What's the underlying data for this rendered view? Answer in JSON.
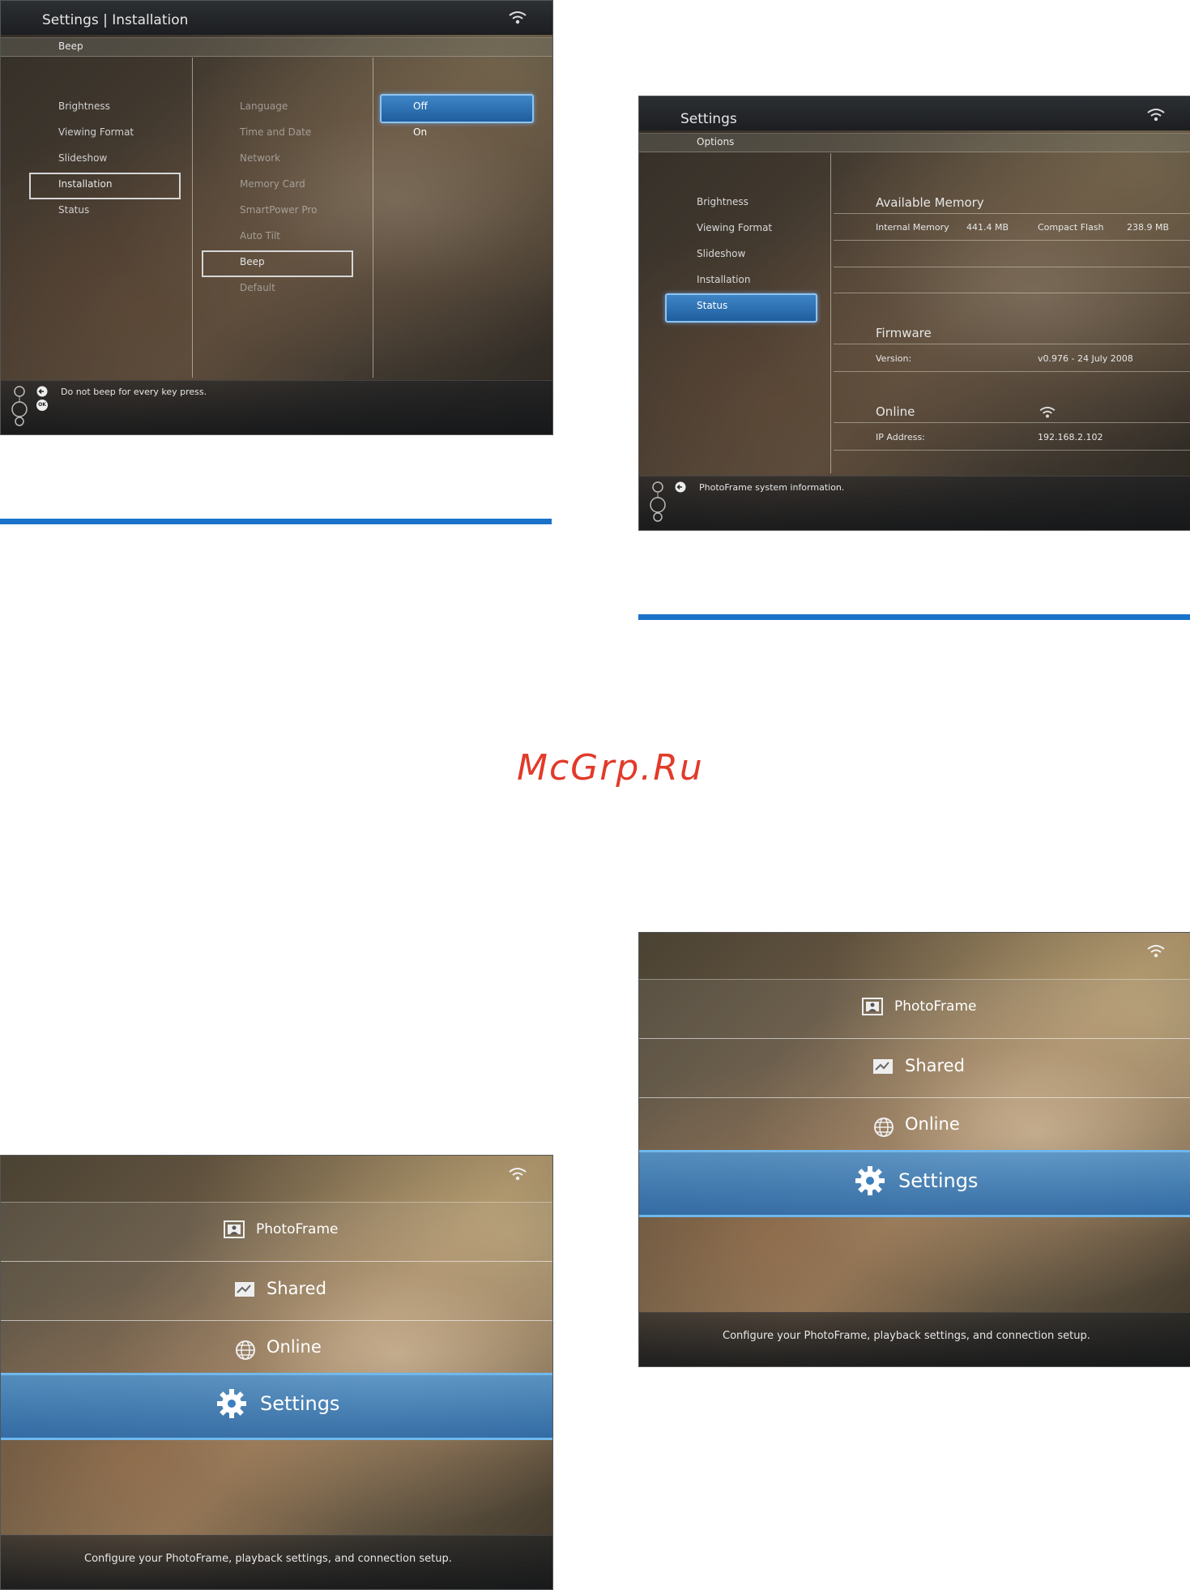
{
  "screen1": {
    "title": "Settings | Installation",
    "subtitle": "Beep",
    "left_menu": [
      "Brightness",
      "Viewing Format",
      "Slideshow",
      "Installation",
      "Status"
    ],
    "left_selected": "Installation",
    "mid_menu": [
      "Language",
      "Time and Date",
      "Network",
      "Memory Card",
      "SmartPower Pro",
      "Auto Tilt",
      "Beep",
      "Default"
    ],
    "mid_selected": "Beep",
    "options": [
      "Off",
      "On"
    ],
    "option_selected": "Off",
    "footer_text": "Do not beep for every key press.",
    "ok_label": "OK",
    "icons": [
      "wifi-icon",
      "back-icon",
      "ok-icon",
      "navigation-icon"
    ]
  },
  "screen2": {
    "title": "Settings",
    "subtitle": "Options",
    "left_menu": [
      "Brightness",
      "Viewing Format",
      "Slideshow",
      "Installation",
      "Status"
    ],
    "left_selected": "Status",
    "memory_heading": "Available Memory",
    "internal_memory_label": "Internal Memory",
    "internal_memory_value": "441.4 MB",
    "compact_flash_label": "Compact Flash",
    "compact_flash_value": "238.9 MB",
    "firmware_heading": "Firmware",
    "version_label": "Version:",
    "version_value": "v0.976 - 24 July 2008",
    "online_heading": "Online",
    "ip_label": "IP Address:",
    "ip_value": "192.168.2.102",
    "footer_text": "PhotoFrame system information.",
    "icons": [
      "wifi-icon",
      "back-icon",
      "navigation-icon"
    ]
  },
  "screen3": {
    "menu": [
      "PhotoFrame",
      "Shared",
      "Online",
      "Settings"
    ],
    "selected": "Settings",
    "footer_text": "Configure your PhotoFrame, playback settings, and connection setup.",
    "icons": [
      "wifi-icon",
      "photoframe-icon",
      "shared-icon",
      "globe-icon",
      "gear-icon"
    ]
  },
  "screen4": {
    "menu": [
      "PhotoFrame",
      "Shared",
      "Online",
      "Settings"
    ],
    "selected": "Settings",
    "footer_text": "Configure your PhotoFrame, playback settings, and connection setup.",
    "icons": [
      "wifi-icon",
      "photoframe-icon",
      "shared-icon",
      "globe-icon",
      "gear-icon"
    ]
  },
  "watermark": "McGrp.Ru",
  "colors": {
    "rule_blue": "#1a73c8",
    "selection_blue": "#2f74b8",
    "watermark_red": "#e23a2a"
  }
}
